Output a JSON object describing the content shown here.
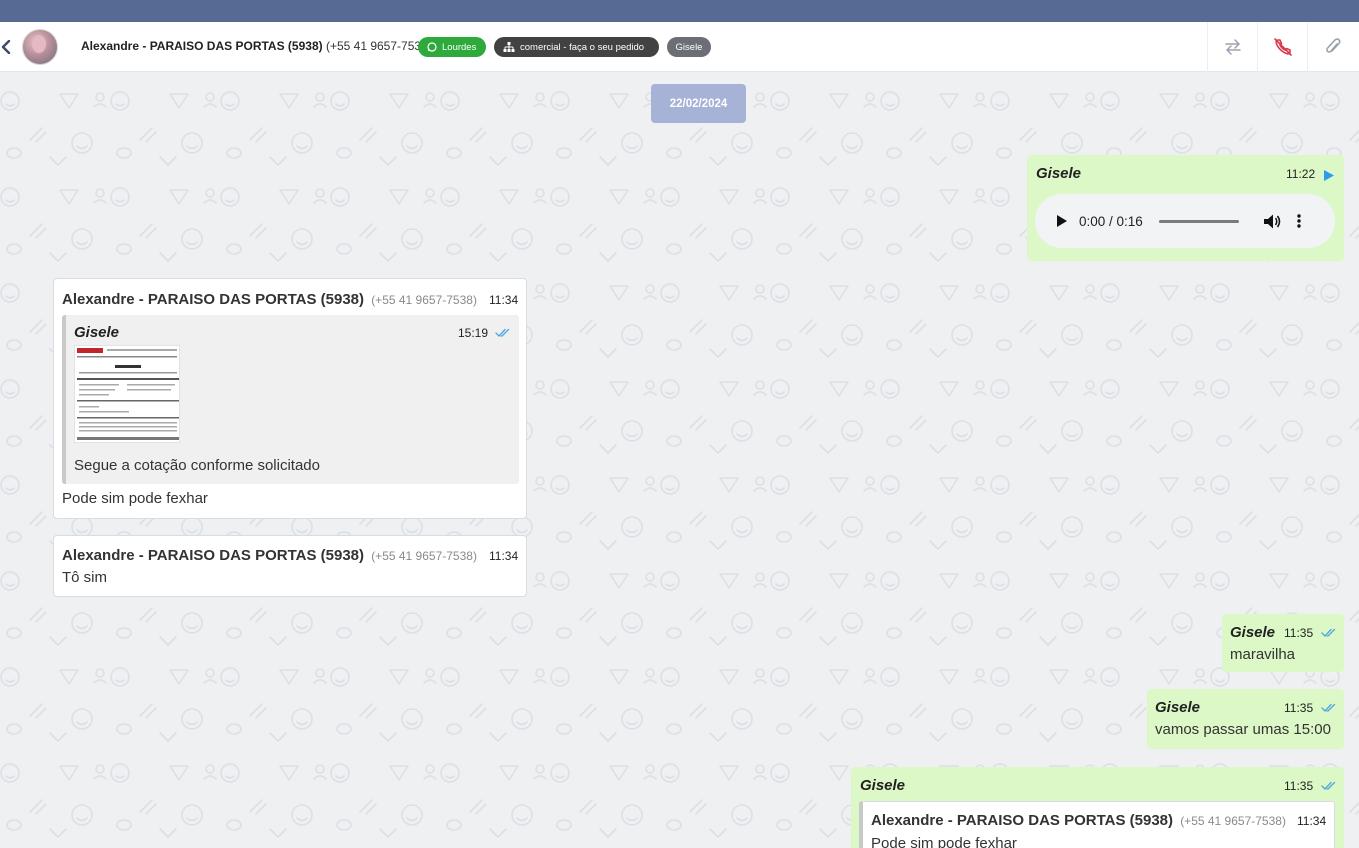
{
  "header": {
    "contact_name": "Alexandre - PARAISO DAS PORTAS (5938)",
    "contact_phone": "(+55 41 9657-7538)",
    "tags": {
      "whatsapp": "Lourdes",
      "queue": "comercial - faça o seu pedido",
      "user": "Gisele"
    },
    "icons": [
      "chevron-left-icon",
      "swap-arrows-icon",
      "hangup-phone-icon",
      "paperclip-icon"
    ]
  },
  "chat": {
    "date_separator": "22/02/2024",
    "messages": [
      {
        "sender": "Gisele",
        "time": "11:22",
        "audio": {
          "position": "0:00",
          "duration": "0:16",
          "display": "0:00 / 0:16"
        }
      },
      {
        "sender": "Alexandre - PARAISO DAS PORTAS (5938)",
        "phone": "(+55 41 9657-7538)",
        "time": "11:34",
        "quote": {
          "sender": "Gisele",
          "time": "15:19",
          "caption": "Segue a cotação conforme solicitado"
        },
        "text": "Pode sim pode fexhar"
      },
      {
        "sender": "Alexandre - PARAISO DAS PORTAS (5938)",
        "phone": "(+55 41 9657-7538)",
        "time": "11:34",
        "text": "Tô sim"
      },
      {
        "sender": "Gisele",
        "time": "11:35",
        "text": "maravilha"
      },
      {
        "sender": "Gisele",
        "time": "11:35",
        "text": "vamos passar umas 15:00"
      },
      {
        "sender": "Gisele",
        "time": "11:35",
        "quote": {
          "sender": "Alexandre - PARAISO DAS PORTAS (5938)",
          "phone": "(+55 41 9657-7538)",
          "time": "11:34",
          "text": "Pode sim pode fexhar"
        }
      }
    ]
  },
  "colors": {
    "topbar": "#566a93",
    "outgoing_bubble": "#dcf8c6",
    "incoming_bubble": "#ffffff",
    "read_ticks": "#4fa6e0",
    "whatsapp_tag": "#2eaa3c",
    "queue_tag": "#424242",
    "user_tag": "#6b6f75",
    "date_pill": "#a6b2d6",
    "hangup_icon": "#d93a4a"
  }
}
